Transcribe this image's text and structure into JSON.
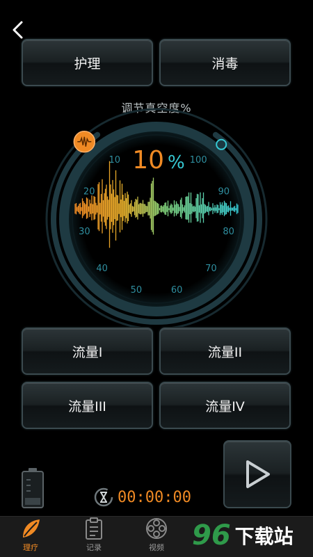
{
  "header": {
    "back_icon": "chevron-left-icon"
  },
  "modes": [
    {
      "label": "护理"
    },
    {
      "label": "消毒"
    }
  ],
  "gauge": {
    "title": "调节真空度%",
    "value_display": "10",
    "unit": "%",
    "value": 10,
    "scale_min": 10,
    "scale_max": 100,
    "ticks": [
      "10",
      "20",
      "30",
      "40",
      "50",
      "60",
      "70",
      "80",
      "90",
      "100"
    ],
    "colors": {
      "accent": "#f08a24",
      "cyan": "#36c9d4",
      "ring": "#1f3840",
      "tick": "#2f8fa0"
    }
  },
  "flows": [
    {
      "label": "流量I"
    },
    {
      "label": "流量II"
    },
    {
      "label": "流量III"
    },
    {
      "label": "流量IV"
    }
  ],
  "timer": {
    "value": "00:00:00",
    "icon": "hourglass-timer-icon"
  },
  "play_button": {
    "icon": "play-icon"
  },
  "battery": {
    "icon": "battery-icon"
  },
  "bottom_nav": [
    {
      "label": "理疗",
      "icon": "leaf-icon",
      "active": true
    },
    {
      "label": "记录",
      "icon": "clipboard-icon",
      "active": false
    },
    {
      "label": "视频",
      "icon": "film-reel-icon",
      "active": false
    }
  ],
  "watermark": {
    "number": "96",
    "text": "下载站"
  }
}
